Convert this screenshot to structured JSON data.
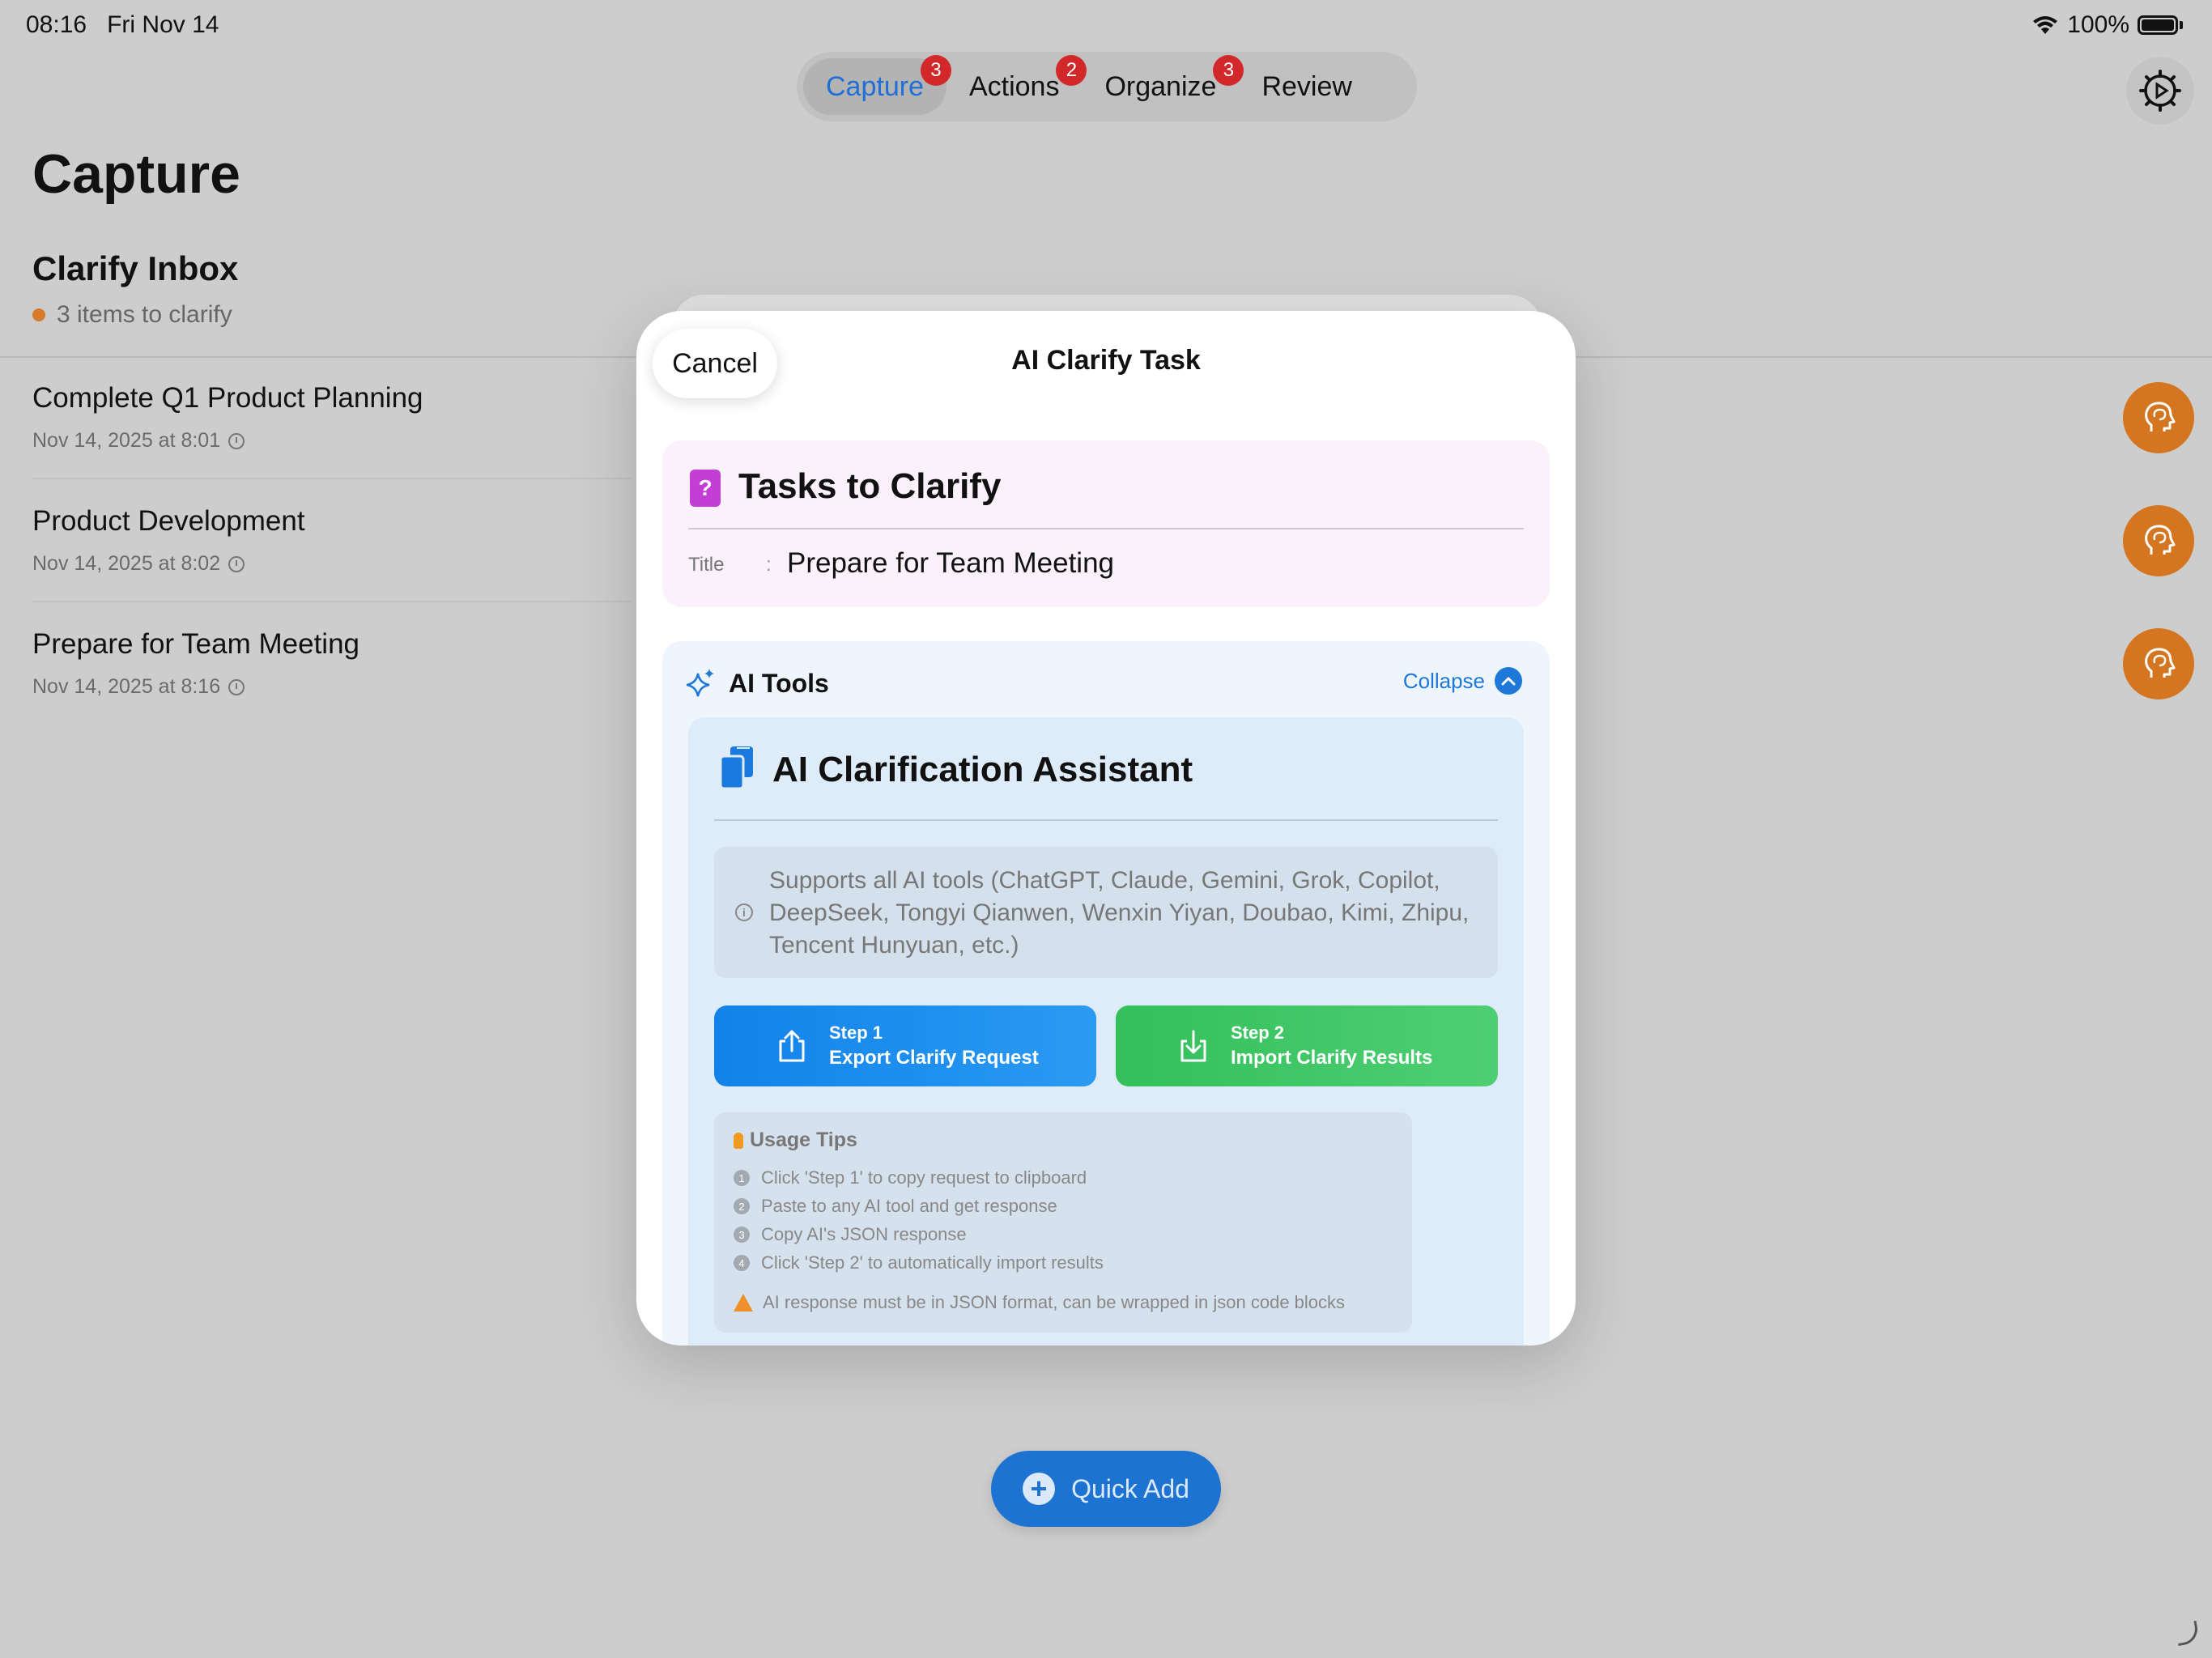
{
  "status_bar": {
    "time": "08:16",
    "date": "Fri Nov 14",
    "battery": "100%"
  },
  "tabs": [
    {
      "label": "Capture",
      "badge": "3",
      "active": true
    },
    {
      "label": "Actions",
      "badge": "2",
      "active": false
    },
    {
      "label": "Organize",
      "badge": "3",
      "active": false
    },
    {
      "label": "Review",
      "badge": "",
      "active": false
    }
  ],
  "page": {
    "title": "Capture",
    "inbox_title": "Clarify Inbox",
    "inbox_count": "3 items to clarify"
  },
  "items": [
    {
      "title": "Complete Q1 Product Planning",
      "date": "Nov 14, 2025 at 8:01"
    },
    {
      "title": "Product Development",
      "date": "Nov 14, 2025 at 8:02"
    },
    {
      "title": "Prepare for Team Meeting",
      "date": "Nov 14, 2025 at 8:16"
    }
  ],
  "quick_add": "Quick Add",
  "sheet": {
    "cancel": "Cancel",
    "title": "AI Clarify Task",
    "task_card": {
      "heading": "Tasks to Clarify",
      "label": "Title",
      "separator": ":",
      "value": "Prepare for Team Meeting"
    },
    "tools": {
      "title": "AI Tools",
      "collapse": "Collapse",
      "assistant_title": "AI Clarification Assistant",
      "info": "Supports all AI tools (ChatGPT, Claude, Gemini, Grok, Copilot, DeepSeek, Tongyi Qianwen, Wenxin Yiyan, Doubao, Kimi, Zhipu, Tencent Hunyuan, etc.)",
      "step1": {
        "num": "Step 1",
        "label": "Export Clarify Request"
      },
      "step2": {
        "num": "Step 2",
        "label": "Import Clarify Results"
      },
      "tips_title": "Usage Tips",
      "tips": [
        {
          "num": "1",
          "text": "Click 'Step 1' to copy request to clipboard"
        },
        {
          "num": "2",
          "text": "Paste to any AI tool and get response"
        },
        {
          "num": "3",
          "text": "Copy AI's JSON response"
        },
        {
          "num": "4",
          "text": "Click 'Step 2' to automatically import results"
        }
      ],
      "warning": "AI response must be in JSON format, can be wrapped in json code blocks"
    }
  },
  "colors": {
    "accent": "#1e6fd6",
    "badge": "#d2282a",
    "brain": "#d4751f",
    "step1": "#1282ea",
    "step2": "#33c05a"
  }
}
